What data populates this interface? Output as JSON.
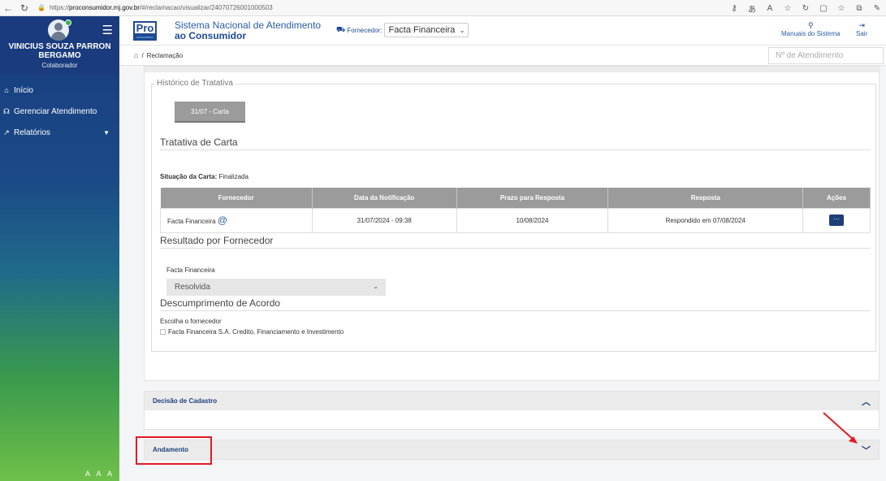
{
  "browser": {
    "url_prefix": "https://",
    "url_host": "proconsumidor.mj.gov.br",
    "url_path": "/#/reclamacao/visualizar/24070726001000503"
  },
  "sidebar": {
    "user_name": "VINICIUS SOUZA PARRON BERGAMO",
    "user_role": "Colaborador",
    "items": [
      {
        "label": "Início",
        "icon": "home-icon"
      },
      {
        "label": "Gerenciar Atendimento",
        "icon": "headset-icon"
      },
      {
        "label": "Relatórios",
        "icon": "chart-icon"
      }
    ],
    "font_size_controls": "A A A"
  },
  "header": {
    "logo_text": "Pro",
    "logo_sub": "consumidor",
    "system_name_1": "Sistema Nacional de Atendimento",
    "system_name_2": "ao Consumidor",
    "supplier_label": "Fornecedor:",
    "supplier_value": "Facta Financeira",
    "manuals_label": "Manuais do Sistema",
    "exit_label": "Sair"
  },
  "breadcrumb": {
    "current": "Reclamação",
    "attendance_placeholder": "Nº de Atendimento"
  },
  "history": {
    "legend": "Histórico de Tratativa",
    "tab_label": "31/07 - Carta",
    "section_title": "Tratativa de Carta",
    "situation_label": "Situação da Carta:",
    "situation_value": "Finalizada",
    "table": {
      "headers": [
        "Fornecedor",
        "Data da Notificação",
        "Prazo para Resposta",
        "Resposta",
        "Ações"
      ],
      "rows": [
        {
          "fornecedor": "Facta Financeira",
          "data": "31/07/2024 - 09:38",
          "prazo": "10/08/2024",
          "resposta": "Respondido em 07/08/2024",
          "acao": "···"
        }
      ]
    },
    "result_title": "Resultado por Fornecedor",
    "result_supplier": "Facta Financeira",
    "result_value": "Resolvida",
    "breach_title": "Descumprimento de Acordo",
    "breach_label": "Escolha o fornecedor",
    "breach_option": "Facta Financeira S.A. Credito, Financiamento e Investimento"
  },
  "accordions": [
    {
      "label": "Decisão de Cadastro",
      "state": "expanded"
    },
    {
      "label": "Andamento",
      "state": "collapsed"
    }
  ],
  "colors": {
    "navy": "#1e3f78",
    "highlight": "#e31b23"
  }
}
